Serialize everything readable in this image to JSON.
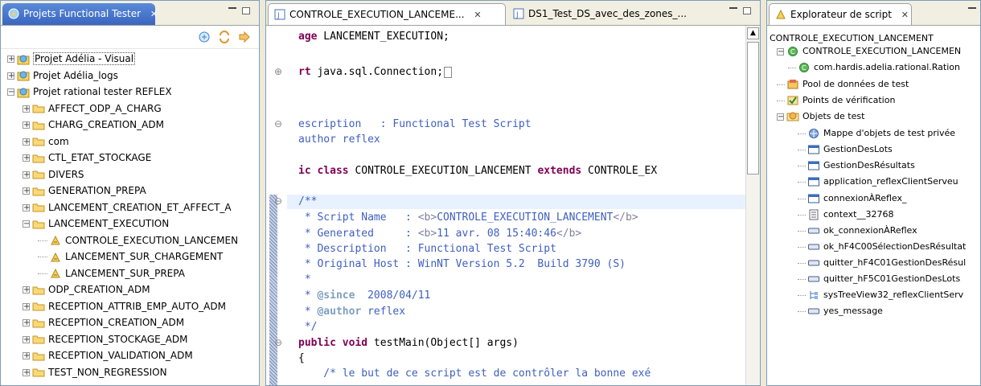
{
  "left_panel": {
    "tab_title": "Projets Functional Tester",
    "tree": [
      {
        "label": "Projet Adélia - Visual",
        "level": 0,
        "expanded": false,
        "icon": "project-icon"
      },
      {
        "label": "Projet Adélia_logs",
        "level": 0,
        "expanded": false,
        "icon": "project-icon"
      },
      {
        "label": "Projet rational tester REFLEX",
        "level": 0,
        "expanded": true,
        "icon": "project-icon"
      },
      {
        "label": "AFFECT_ODP_A_CHARG",
        "level": 1,
        "expanded": false,
        "icon": "folder-icon"
      },
      {
        "label": "CHARG_CREATION_ADM",
        "level": 1,
        "expanded": false,
        "icon": "folder-icon"
      },
      {
        "label": "com",
        "level": 1,
        "expanded": false,
        "icon": "folder-icon"
      },
      {
        "label": "CTL_ETAT_STOCKAGE",
        "level": 1,
        "expanded": false,
        "icon": "folder-icon"
      },
      {
        "label": "DIVERS",
        "level": 1,
        "expanded": false,
        "icon": "folder-icon"
      },
      {
        "label": "GENERATION_PREPA",
        "level": 1,
        "expanded": false,
        "icon": "folder-icon"
      },
      {
        "label": "LANCEMENT_CREATION_ET_AFFECT_A",
        "level": 1,
        "expanded": false,
        "icon": "folder-icon"
      },
      {
        "label": "LANCEMENT_EXECUTION",
        "level": 1,
        "expanded": true,
        "icon": "folder-icon"
      },
      {
        "label": "CONTROLE_EXECUTION_LANCEMEN",
        "level": 2,
        "expanded": null,
        "icon": "script-icon"
      },
      {
        "label": "LANCEMENT_SUR_CHARGEMENT",
        "level": 2,
        "expanded": null,
        "icon": "script-icon"
      },
      {
        "label": "LANCEMENT_SUR_PREPA",
        "level": 2,
        "expanded": null,
        "icon": "script-icon"
      },
      {
        "label": "ODP_CREATION_ADM",
        "level": 1,
        "expanded": false,
        "icon": "folder-icon"
      },
      {
        "label": "RECEPTION_ATTRIB_EMP_AUTO_ADM",
        "level": 1,
        "expanded": false,
        "icon": "folder-icon"
      },
      {
        "label": "RECEPTION_CREATION_ADM",
        "level": 1,
        "expanded": false,
        "icon": "folder-icon"
      },
      {
        "label": "RECEPTION_STOCKAGE_ADM",
        "level": 1,
        "expanded": false,
        "icon": "folder-icon"
      },
      {
        "label": "RECEPTION_VALIDATION_ADM",
        "level": 1,
        "expanded": false,
        "icon": "folder-icon"
      },
      {
        "label": "TEST_NON_REGRESSION",
        "level": 1,
        "expanded": false,
        "icon": "folder-icon"
      }
    ]
  },
  "editor": {
    "tabs": [
      {
        "label": "CONTROLE_EXECUTION_LANCEME...",
        "active": true,
        "close": "×"
      },
      {
        "label": "DS1_Test_DS_avec_des_zones_...",
        "active": false,
        "close": ""
      }
    ],
    "lines": [
      {
        "text": "age LANCEMENT_EXECUTION;",
        "style": "plain"
      },
      {
        "text": "rt java.sql.Connection;",
        "style": "import"
      },
      {
        "text": "escription   : Functional Test Script",
        "style": "com"
      },
      {
        "text": "author reflex",
        "style": "com"
      },
      {
        "text": "ic class CONTROLE_EXECUTION_LANCEMENT extends CONTROLE_EX",
        "style": "class"
      },
      {
        "text": "/**",
        "style": "com"
      },
      {
        "text": " * Script Name   : <b>CONTROLE_EXECUTION_LANCEMENT</b>",
        "style": "com"
      },
      {
        "text": " * Generated     : <b>11 avr. 08 15:40:46</b>",
        "style": "com"
      },
      {
        "text": " * Description   : Functional Test Script",
        "style": "com"
      },
      {
        "text": " * Original Host : WinNT Version 5.2  Build 3790 (S)",
        "style": "com"
      },
      {
        "text": " *",
        "style": "com"
      },
      {
        "text": " * @since  2008/04/11",
        "style": "com"
      },
      {
        "text": " * @author reflex",
        "style": "com"
      },
      {
        "text": " */",
        "style": "com"
      },
      {
        "text": "public void testMain(Object[] args)",
        "style": "method"
      },
      {
        "text": "{",
        "style": "plain"
      },
      {
        "text": "    /* le but de ce script est de contrôler la bonne exé",
        "style": "com"
      }
    ]
  },
  "right_panel": {
    "tab_title": "Explorateur de script",
    "header": "CONTROLE_EXECUTION_LANCEMENT",
    "tree": [
      {
        "label": "CONTROLE_EXECUTION_LANCEMEN",
        "level": 1,
        "icon": "class-icon"
      },
      {
        "label": "com.hardis.adelia.rational.Ration",
        "level": 2,
        "icon": "class-icon"
      },
      {
        "label": "Pool de données de test",
        "level": 1,
        "icon": "datapool-icon"
      },
      {
        "label": "Points de vérification",
        "level": 1,
        "icon": "verification-icon"
      },
      {
        "label": "Objets de test",
        "level": 1,
        "icon": "test-objects-icon"
      },
      {
        "label": "Mappe d'objets de test privée",
        "level": 2,
        "icon": "map-icon"
      },
      {
        "label": "GestionDesLots",
        "level": 2,
        "icon": "window-icon"
      },
      {
        "label": "GestionDesRésultats",
        "level": 2,
        "icon": "window-icon"
      },
      {
        "label": "application_reflexClientServeu",
        "level": 2,
        "icon": "window-icon"
      },
      {
        "label": "connexionÀReflex_",
        "level": 2,
        "icon": "window-icon"
      },
      {
        "label": "context__32768",
        "level": 2,
        "icon": "context-icon"
      },
      {
        "label": "ok_connexionÀReflex",
        "level": 2,
        "icon": "button-icon"
      },
      {
        "label": "ok_hF4C00SélectionDesRésultat",
        "level": 2,
        "icon": "button-icon"
      },
      {
        "label": "quitter_hF4C01GestionDesRésul",
        "level": 2,
        "icon": "button-icon"
      },
      {
        "label": "quitter_hF5C01GestionDesLots",
        "level": 2,
        "icon": "button-icon"
      },
      {
        "label": "sysTreeView32_reflexClientServ",
        "level": 2,
        "icon": "treeview-icon"
      },
      {
        "label": "yes_message",
        "level": 2,
        "icon": "button-icon"
      }
    ]
  },
  "colors": {
    "keyword": "#7f0055",
    "comment": "#3f5fbf",
    "active_tab": "#3a66c0",
    "folder": "#f2c45c"
  }
}
